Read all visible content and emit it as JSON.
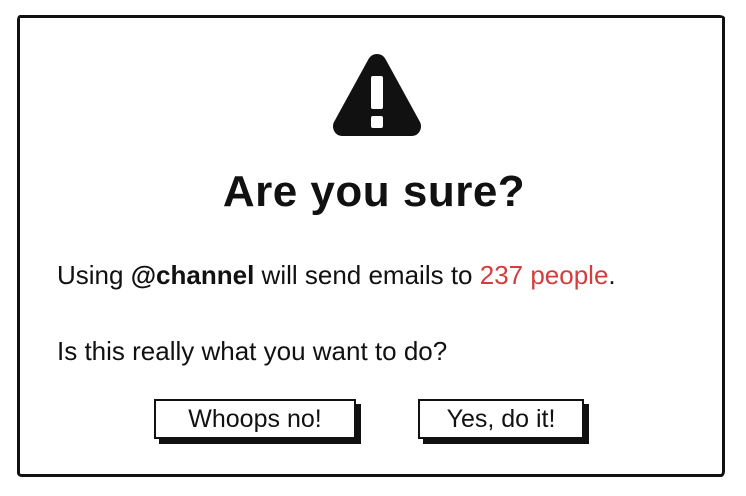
{
  "dialog": {
    "icon": "warning-triangle-icon",
    "title": "Are you sure?",
    "message": {
      "prefix": "Using ",
      "mention": "@channel",
      "middle": " will send emails to ",
      "count_text": "237 people",
      "suffix": "."
    },
    "question": "Is this really what you want to do?",
    "buttons": {
      "cancel_label": "Whoops no!",
      "confirm_label": "Yes, do it!"
    }
  },
  "colors": {
    "highlight": "#d33d3d",
    "ink": "#111111",
    "background": "#ffffff"
  }
}
